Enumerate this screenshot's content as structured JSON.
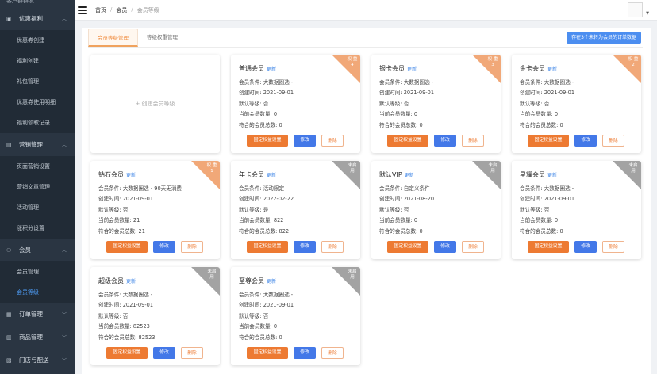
{
  "sidebar": {
    "top_cut": "客户群群发",
    "groups": [
      {
        "label": "优惠福利",
        "items": [
          "优惠券创建",
          "福利创建",
          "礼包管理",
          "优惠券使用明细",
          "福利领取记录"
        ]
      },
      {
        "label": "营销管理",
        "items": [
          "页面营销设置",
          "营销文章管理",
          "活动管理",
          "涨积分设置"
        ]
      },
      {
        "label": "会员",
        "items": [
          "会员管理",
          "会员等级"
        ],
        "active": "会员等级"
      },
      {
        "label": "订单管理",
        "items": []
      },
      {
        "label": "商品管理",
        "items": []
      },
      {
        "label": "门店与配送",
        "items": []
      }
    ]
  },
  "breadcrumb": {
    "home": "首页",
    "parent": "会员",
    "current": "会员等级",
    "sep": "/"
  },
  "tabs": [
    "会员等级管理",
    "等级权重管理"
  ],
  "top_button": "存在3个未转为会员的订单数据",
  "create_label": "+ 创建会员等级",
  "labels": {
    "update": "更新",
    "condition": "会员条件:",
    "created": "创建时间:",
    "default": "默认等级:",
    "current": "当前会员数量:",
    "match": "符合的会员总数:",
    "btn_equity": "固定权益设置",
    "btn_edit": "修改",
    "btn_delete": "删除"
  },
  "cards": [
    {
      "name": "普通会员",
      "condition": "大数据圈选 -",
      "created": "2021-09-01",
      "default": "否",
      "current": "0",
      "match": "0",
      "corner": "weight",
      "corner_text": "权 重",
      "corner_num": "4"
    },
    {
      "name": "银卡会员",
      "condition": "大数据圈选 -",
      "created": "2021-09-01",
      "default": "否",
      "current": "0",
      "match": "0",
      "corner": "weight",
      "corner_text": "权 重",
      "corner_num": "3"
    },
    {
      "name": "金卡会员",
      "condition": "大数据圈选 -",
      "created": "2021-09-01",
      "default": "否",
      "current": "0",
      "match": "0",
      "corner": "weight",
      "corner_text": "权 重",
      "corner_num": "2"
    },
    {
      "name": "钻石会员",
      "condition": "大数据圈选 - 90天无消费",
      "created": "2021-09-01",
      "default": "否",
      "current": "21",
      "match": "21",
      "corner": "weight",
      "corner_text": "权 重",
      "corner_num": "1"
    },
    {
      "name": "年卡会员",
      "condition": "活动限定",
      "created": "2022-02-22",
      "default": "是",
      "current": "822",
      "match": "822",
      "corner": "disabled",
      "corner_text": "未启用",
      "corner_num": ""
    },
    {
      "name": "默认VIP",
      "condition": "自定义条件",
      "created": "2021-08-20",
      "default": "否",
      "current": "0",
      "match": "0",
      "corner": "disabled",
      "corner_text": "未启用",
      "corner_num": ""
    },
    {
      "name": "星耀会员",
      "condition": "大数据圈选 -",
      "created": "2021-09-01",
      "default": "否",
      "current": "0",
      "match": "0",
      "corner": "disabled",
      "corner_text": "未启用",
      "corner_num": ""
    },
    {
      "name": "超级会员",
      "condition": "大数据圈选 -",
      "created": "2021-09-01",
      "default": "否",
      "current": "82523",
      "match": "82523",
      "corner": "disabled",
      "corner_text": "未启用",
      "corner_num": ""
    },
    {
      "name": "至尊会员",
      "condition": "大数据圈选 -",
      "created": "2021-09-01",
      "default": "否",
      "current": "0",
      "match": "0",
      "corner": "disabled",
      "corner_text": "未启用",
      "corner_num": ""
    }
  ],
  "colors": {
    "sidebar_bg": "#2a3542",
    "accent_orange": "#ed7a32",
    "accent_blue": "#4378e8",
    "weight_corner": "#f1a878",
    "disabled_corner": "#a3a3a3"
  }
}
